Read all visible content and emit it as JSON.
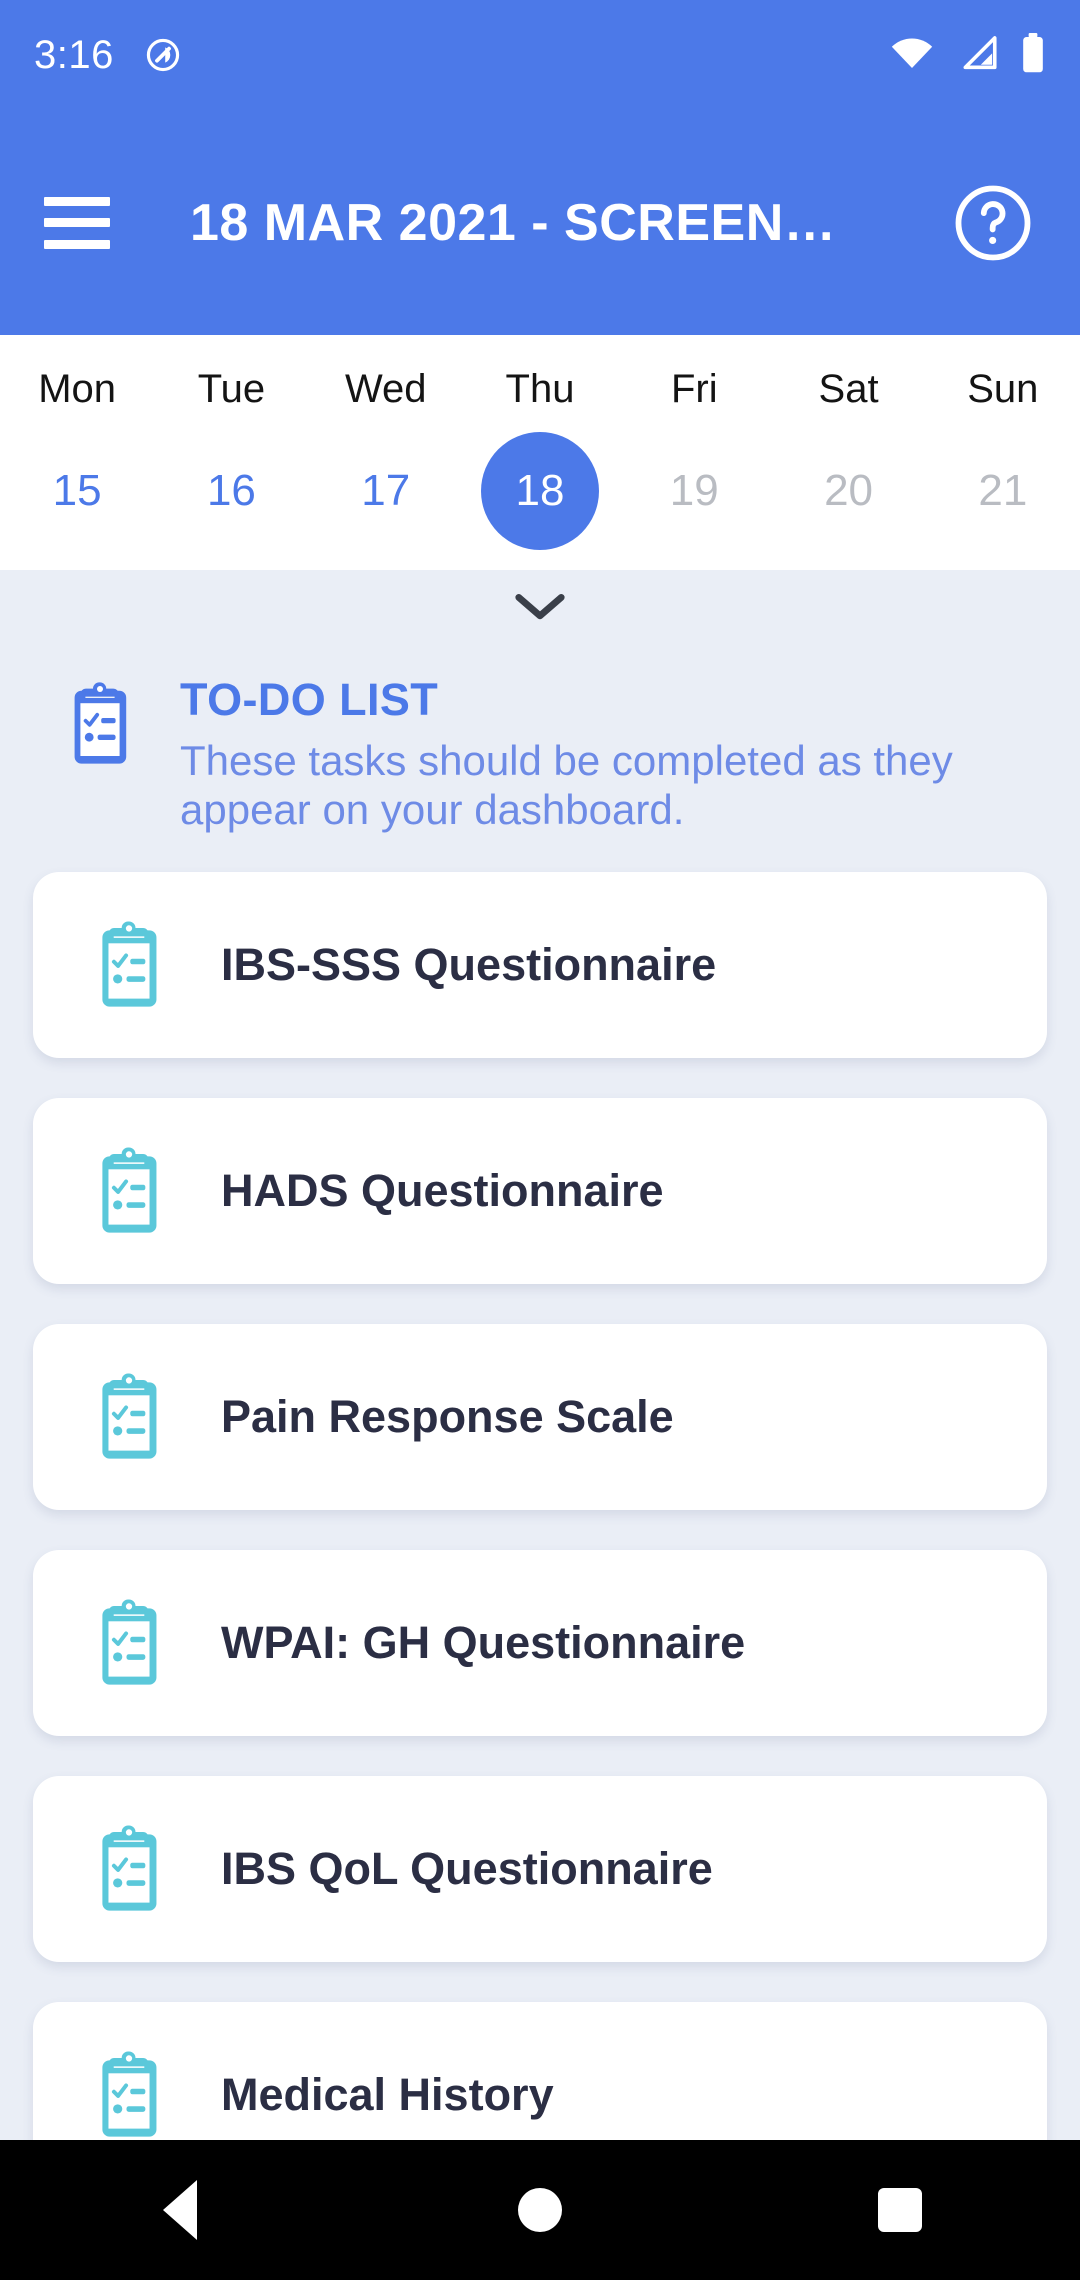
{
  "status_bar": {
    "time": "3:16",
    "icons": [
      "do-not-disturb-icon",
      "wifi-icon",
      "cellular-signal-icon",
      "battery-icon"
    ]
  },
  "app_bar": {
    "menu_icon": "hamburger-menu-icon",
    "title": "18 MAR 2021 - SCREEN…",
    "help_icon": "help-circle-icon"
  },
  "calendar": {
    "day_names": [
      "Mon",
      "Tue",
      "Wed",
      "Thu",
      "Fri",
      "Sat",
      "Sun"
    ],
    "dates": [
      {
        "day": "15",
        "state": "available"
      },
      {
        "day": "16",
        "state": "available"
      },
      {
        "day": "17",
        "state": "available"
      },
      {
        "day": "18",
        "state": "selected"
      },
      {
        "day": "19",
        "state": "disabled"
      },
      {
        "day": "20",
        "state": "disabled"
      },
      {
        "day": "21",
        "state": "disabled"
      }
    ],
    "expand_icon": "chevron-down-icon"
  },
  "todo_section": {
    "icon": "clipboard-checklist-icon",
    "title": "TO-DO LIST",
    "subtitle": "These tasks should be completed as they appear on your dashboard.",
    "tasks": [
      {
        "label": "IBS-SSS Questionnaire",
        "icon": "clipboard-checklist-icon"
      },
      {
        "label": "HADS Questionnaire",
        "icon": "clipboard-checklist-icon"
      },
      {
        "label": "Pain Response Scale",
        "icon": "clipboard-checklist-icon"
      },
      {
        "label": "WPAI: GH Questionnaire",
        "icon": "clipboard-checklist-icon"
      },
      {
        "label": "IBS QoL Questionnaire",
        "icon": "clipboard-checklist-icon"
      },
      {
        "label": "Medical History",
        "icon": "clipboard-checklist-icon"
      }
    ]
  },
  "nav_bar": {
    "back": "back-navigation-icon",
    "home": "home-navigation-icon",
    "recents": "recents-navigation-icon"
  },
  "colors": {
    "primary_blue": "#4C79E8",
    "teal_icon": "#5BC8DA",
    "page_background": "#EAEEF6",
    "card_background": "#FFFFFF",
    "card_text": "#2B2E44",
    "date_disabled": "#B9BCC2"
  }
}
